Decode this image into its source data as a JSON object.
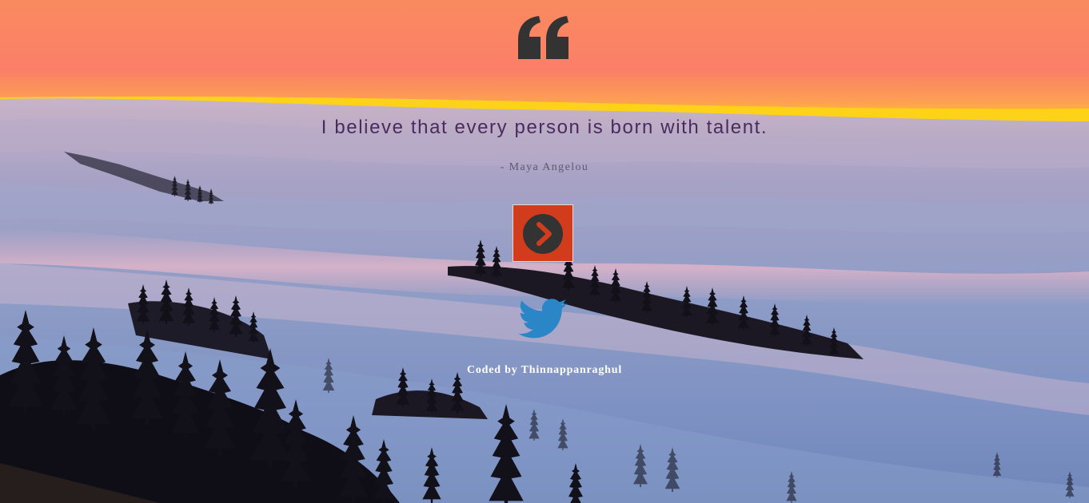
{
  "quote": {
    "text": "I believe that every person is born with talent.",
    "author": "- Maya Angelou"
  },
  "icons": {
    "quote_mark": "quote-left-icon",
    "next": "chevron-right-circle-icon",
    "share": "twitter-icon"
  },
  "footer": {
    "credit": "Coded by Thinnappanraghul"
  },
  "colors": {
    "quote_text": "#4a2b5e",
    "button": "#d13d1c",
    "button_icon": "#333333",
    "twitter": "#2b86c8",
    "sky_top": "#f98a62",
    "horizon_glow": "#ffcc1f"
  }
}
